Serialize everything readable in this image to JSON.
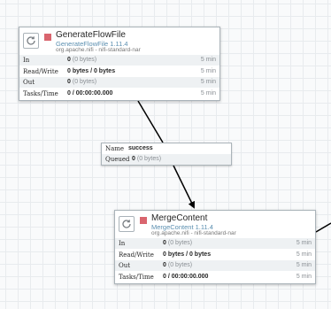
{
  "processors": [
    {
      "name": "GenerateFlowFile",
      "type": "GenerateFlowFile 1.11.4",
      "bundle": "org.apache.nifi - nifi-standard-nar",
      "stats": [
        {
          "label": "In",
          "value": "0",
          "sub": "(0 bytes)",
          "period": "5 min"
        },
        {
          "label": "Read/Write",
          "value": "0 bytes / 0 bytes",
          "sub": "",
          "period": "5 min"
        },
        {
          "label": "Out",
          "value": "0",
          "sub": "(0 bytes)",
          "period": "5 min"
        },
        {
          "label": "Tasks/Time",
          "value": "0 / 00:00:00.000",
          "sub": "",
          "period": "5 min"
        }
      ]
    },
    {
      "name": "MergeContent",
      "type": "MergeContent 1.11.4",
      "bundle": "org.apache.nifi - nifi-standard-nar",
      "stats": [
        {
          "label": "In",
          "value": "0",
          "sub": "(0 bytes)",
          "period": "5 min"
        },
        {
          "label": "Read/Write",
          "value": "0 bytes / 0 bytes",
          "sub": "",
          "period": "5 min"
        },
        {
          "label": "Out",
          "value": "0",
          "sub": "(0 bytes)",
          "period": "5 min"
        },
        {
          "label": "Tasks/Time",
          "value": "0 / 00:00:00.000",
          "sub": "",
          "period": "5 min"
        }
      ]
    }
  ],
  "connection": {
    "name_label": "Name",
    "name_value": "success",
    "queued_label": "Queued",
    "queued_value": "0",
    "queued_sub": "(0 bytes)"
  },
  "colors": {
    "stopped_state": "#d9656e",
    "type_text": "#5b8fb0",
    "canvas_grid": "#e8ebee"
  }
}
